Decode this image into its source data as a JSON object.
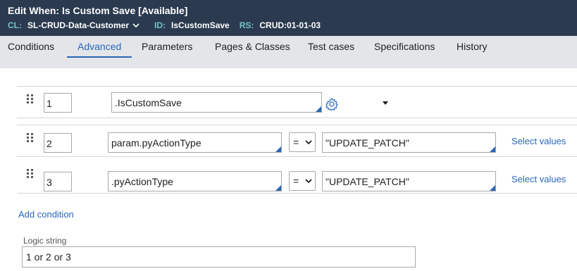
{
  "header": {
    "title": "Edit  When: Is Custom Save [Available]",
    "cl_label": "CL:",
    "cl_value": "SL-CRUD-Data-Customer",
    "id_label": "ID:",
    "id_value": "IsCustomSave",
    "rs_label": "RS:",
    "rs_value": "CRUD:01-01-03"
  },
  "tabs": [
    {
      "label": "Conditions",
      "active": false
    },
    {
      "label": "Advanced",
      "active": true
    },
    {
      "label": "Parameters",
      "active": false
    },
    {
      "label": "Pages & Classes",
      "active": false
    },
    {
      "label": "Test cases",
      "active": false
    },
    {
      "label": "Specifications",
      "active": false
    },
    {
      "label": "History",
      "active": false
    }
  ],
  "conditions": [
    {
      "number": "1",
      "expression": ".IsCustomSave"
    },
    {
      "number": "2",
      "left": "param.pyActionType",
      "operator": "=",
      "right": "\"UPDATE_PATCH\"",
      "select_values": "Select values"
    },
    {
      "number": "3",
      "left": ".pyActionType",
      "operator": "=",
      "right": "\"UPDATE_PATCH\"",
      "select_values": "Select values"
    }
  ],
  "add_condition": "Add condition",
  "logic": {
    "label": "Logic string",
    "value": "1 or 2 or 3"
  },
  "colors": {
    "header_bg": "#2b3a4f",
    "accent": "#2966b8",
    "meta_label": "#78c4c4",
    "tabbar_bg": "#e3e5e8"
  },
  "icons": [
    "chevron-down-icon",
    "drag-handle-icon",
    "gear-icon",
    "dropdown-caret-icon",
    "select-chevron-icon"
  ]
}
